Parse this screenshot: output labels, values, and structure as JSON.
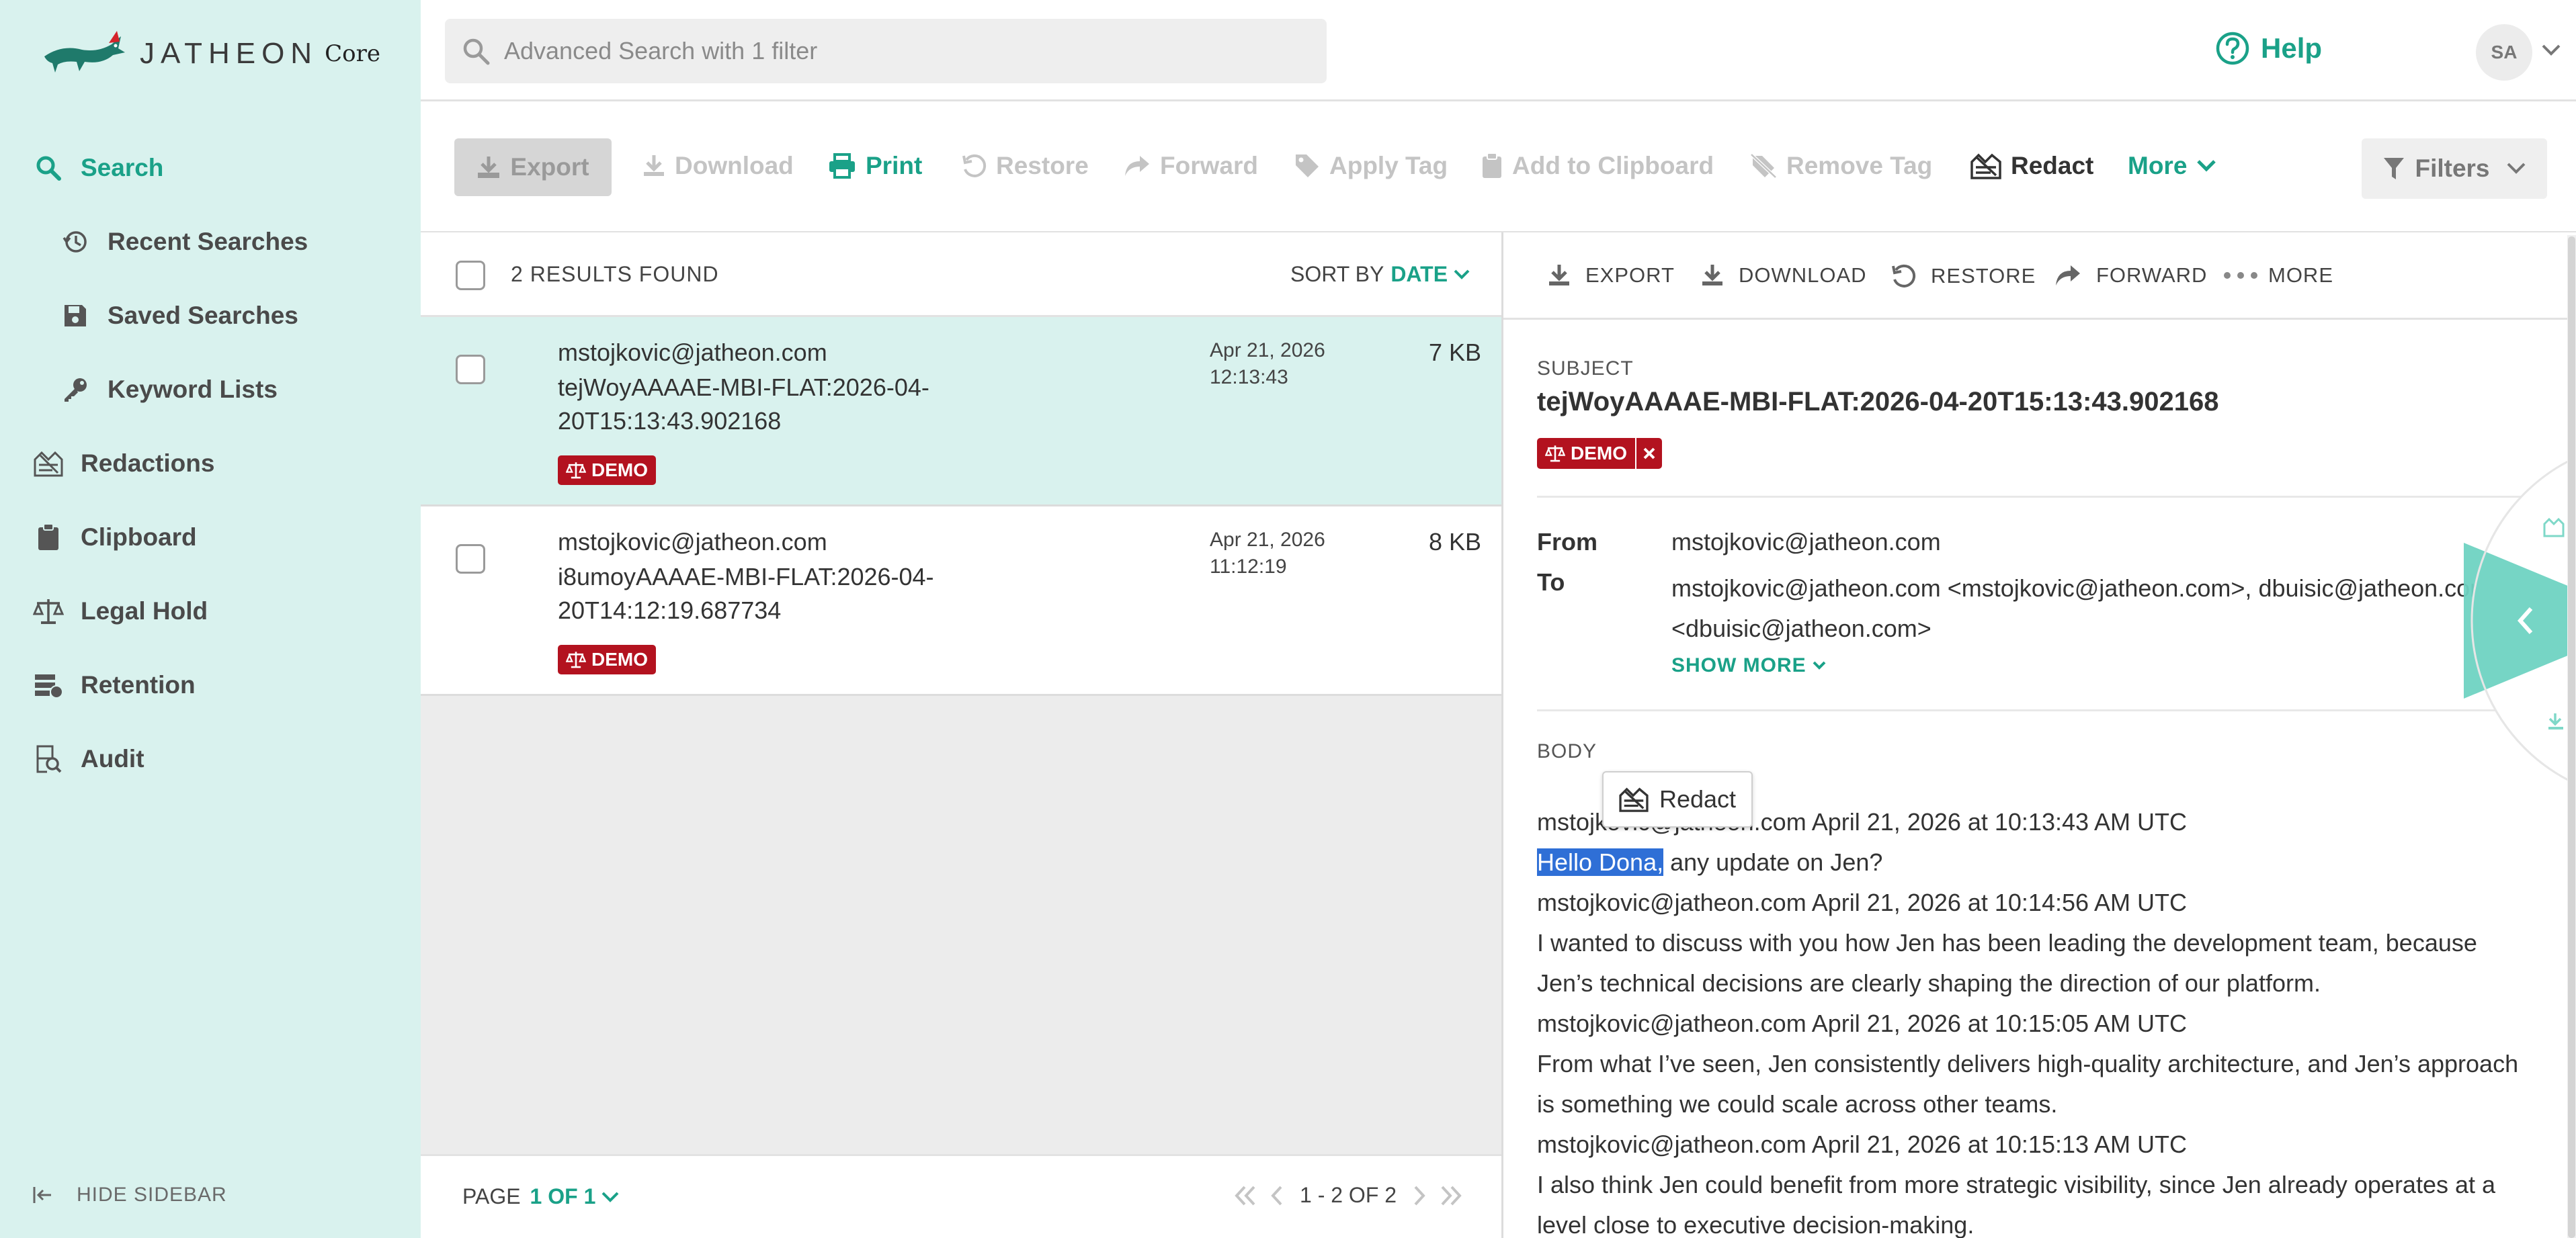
{
  "app": {
    "logo_text": "JATHEON",
    "logo_core": "Core",
    "brand_color": "#1aa188",
    "tag_color": "#b3121f"
  },
  "header": {
    "search_placeholder": "Advanced Search with 1 filter",
    "help_label": "Help",
    "avatar_initials": "SA"
  },
  "sidebar": {
    "items": [
      {
        "label": "Search",
        "icon": "search-icon",
        "active": true
      },
      {
        "label": "Recent Searches",
        "icon": "history-icon"
      },
      {
        "label": "Saved Searches",
        "icon": "save-icon"
      },
      {
        "label": "Keyword Lists",
        "icon": "key-icon"
      },
      {
        "label": "Redactions",
        "icon": "redact-icon"
      },
      {
        "label": "Clipboard",
        "icon": "clipboard-icon"
      },
      {
        "label": "Legal Hold",
        "icon": "scale-icon"
      },
      {
        "label": "Retention",
        "icon": "retention-icon"
      },
      {
        "label": "Audit",
        "icon": "audit-icon"
      }
    ],
    "hide_label": "HIDE SIDEBAR"
  },
  "toolbar": {
    "export": "Export",
    "download": "Download",
    "print": "Print",
    "restore": "Restore",
    "forward": "Forward",
    "apply_tag": "Apply Tag",
    "add_clipboard": "Add to Clipboard",
    "remove_tag": "Remove Tag",
    "redact": "Redact",
    "more": "More",
    "filters": "Filters"
  },
  "results": {
    "count_label": "2 RESULTS FOUND",
    "sort_prefix": "SORT BY",
    "sort_value": "DATE",
    "rows": [
      {
        "sender": "mstojkovic@jatheon.com",
        "subject_line1": "tejWoyAAAAE-MBI-FLAT:2026-04-",
        "subject_line2": "20T15:13:43.902168",
        "date": "Apr 21, 2026",
        "time": "12:13:43",
        "size": "7 KB",
        "tag": "DEMO",
        "selected": true
      },
      {
        "sender": "mstojkovic@jatheon.com",
        "subject_line1": "i8umoyAAAAE-MBI-FLAT:2026-04-",
        "subject_line2": "20T14:12:19.687734",
        "date": "Apr 21, 2026",
        "time": "11:12:19",
        "size": "8 KB",
        "tag": "DEMO",
        "selected": false
      }
    ],
    "footer": {
      "page_prefix": "PAGE",
      "page_value": "1 OF 1",
      "range": "1 - 2 OF 2"
    }
  },
  "detail": {
    "toolbar": {
      "export": "EXPORT",
      "download": "DOWNLOAD",
      "restore": "RESTORE",
      "forward": "FORWARD",
      "more": "MORE"
    },
    "subject_label": "SUBJECT",
    "subject": "tejWoyAAAAE-MBI-FLAT:2026-04-20T15:13:43.902168",
    "tag": "DEMO",
    "from_label": "From",
    "from": "mstojkovic@jatheon.com",
    "to_label": "To",
    "to_line1": "mstojkovic@jatheon.com <mstojkovic@jatheon.com>, dbuisic@jatheon.com",
    "to_line2": "<dbuisic@jatheon.com>",
    "show_more": "SHOW MORE",
    "body_label": "BODY",
    "redact_popup": "Redact",
    "body": {
      "l1": "mstojkovic@jatheon.com April 21, 2026 at 10:13:43 AM UTC",
      "l2_sel": "Hello Dona,",
      "l2_rest": " any update on Jen?",
      "l3": "mstojkovic@jatheon.com April 21, 2026 at 10:14:56 AM UTC",
      "l4": "I wanted to discuss with you how Jen has been leading the development team, because",
      "l5": "Jen’s technical decisions are clearly shaping the direction of our platform.",
      "l6": "mstojkovic@jatheon.com April 21, 2026 at 10:15:05 AM UTC",
      "l7": "From what I’ve seen, Jen consistently delivers high-quality architecture, and Jen’s approach",
      "l8": "is something we could scale across other teams.",
      "l9": "mstojkovic@jatheon.com April 21, 2026 at 10:15:13 AM UTC",
      "l10": "I also think Jen could benefit from more strategic visibility, since Jen already operates at a",
      "l11": "level close to executive decision-making."
    }
  }
}
